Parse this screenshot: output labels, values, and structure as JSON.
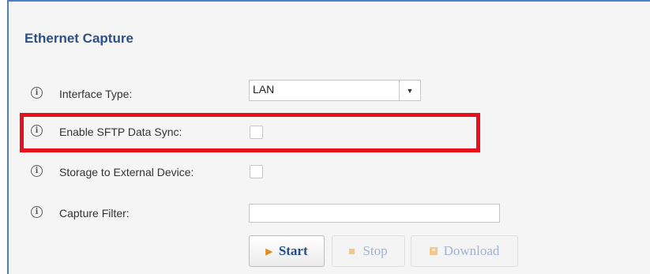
{
  "section": {
    "title": "Ethernet Capture"
  },
  "rows": [
    {
      "label": "Interface Type:",
      "icon": "info-icon"
    },
    {
      "label": "Enable SFTP Data Sync:",
      "icon": "info-icon"
    },
    {
      "label": "Storage to External Device:",
      "icon": "info-icon"
    },
    {
      "label": "Capture Filter:",
      "icon": "info-icon"
    }
  ],
  "interface_type": {
    "selected": "LAN"
  },
  "fields": {
    "enable_sftp_sync_checked": false,
    "storage_external_checked": false,
    "capture_filter_value": ""
  },
  "buttons": {
    "start": "Start",
    "stop": "Stop",
    "download": "Download"
  },
  "colors": {
    "title": "#2c5187",
    "highlight": "#e8101a",
    "panel_border": "#4d7fc4",
    "start_icon": "#e68a1a"
  }
}
